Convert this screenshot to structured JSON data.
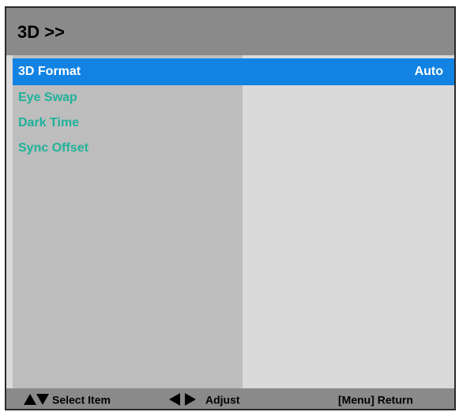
{
  "header": {
    "title": "3D >>"
  },
  "menu": {
    "items": [
      {
        "label": "3D Format",
        "value": "Auto",
        "selected": true
      },
      {
        "label": "Eye Swap",
        "value": "",
        "selected": false
      },
      {
        "label": "Dark Time",
        "value": "",
        "selected": false
      },
      {
        "label": "Sync Offset",
        "value": "",
        "selected": false
      }
    ]
  },
  "footer": {
    "select_label": "Select Item",
    "adjust_label": "Adjust",
    "return_label": "[Menu] Return"
  },
  "icons": {
    "up": "triangle-up-icon",
    "down": "triangle-down-icon",
    "left": "triangle-left-icon",
    "right": "triangle-right-icon"
  },
  "colors": {
    "header_bg": "#8a8a8a",
    "selected_bg": "#1283e3",
    "item_text": "#1fb29a",
    "left_pane_bg": "#bdbdbd",
    "right_pane_bg": "#dadada"
  }
}
